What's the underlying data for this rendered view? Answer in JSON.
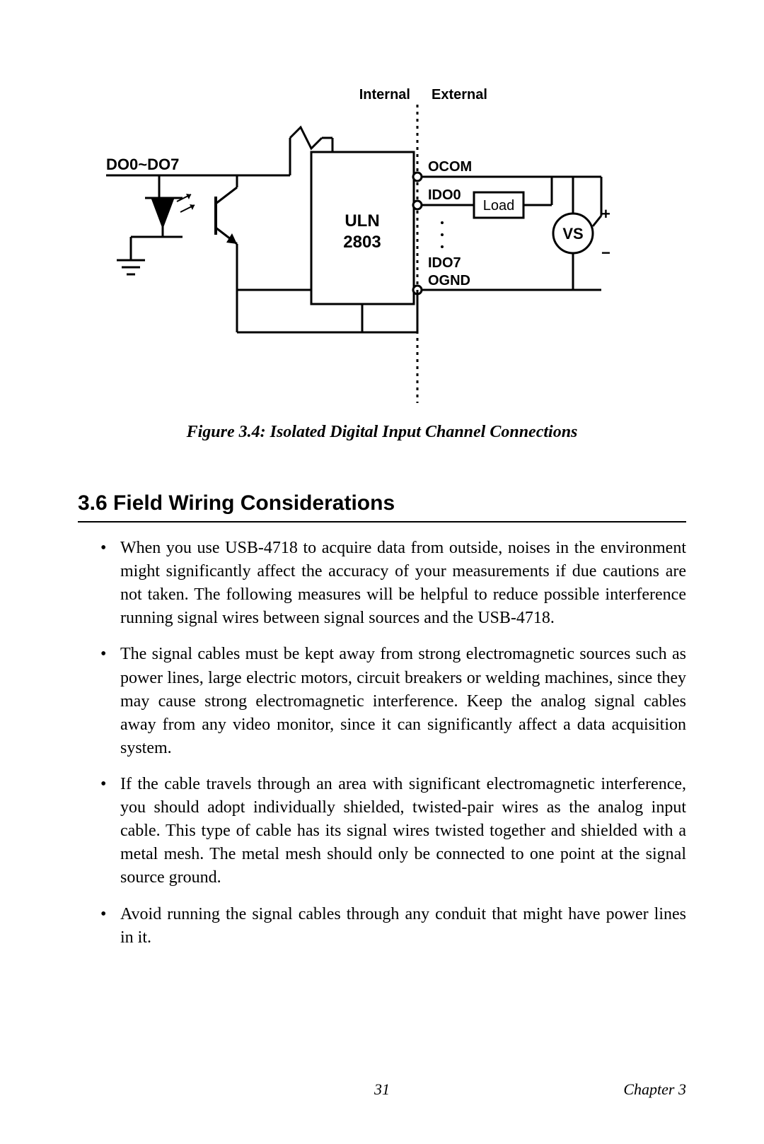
{
  "diagram": {
    "label_internal": "Internal",
    "label_external": "External",
    "do_range": "DO0~DO7",
    "ocom": "OCOM",
    "ido0": "IDO0",
    "ido7": "IDO7",
    "ognd": "OGND",
    "load": "Load",
    "vs": "VS",
    "plus": "+",
    "minus": "−",
    "chip_line1": "ULN",
    "chip_line2": "2803"
  },
  "figure_caption": "Figure 3.4: Isolated Digital Input Channel Connections",
  "section_heading": "3.6  Field Wiring Considerations",
  "bullets": [
    "When you use USB-4718 to acquire data from outside, noises in the environment might significantly affect the accuracy of your measurements if due cautions are not taken. The following measures will be helpful to reduce possible interference running signal wires between signal sources and the USB-4718.",
    "The signal cables must be kept away from strong electromagnetic sources such as power lines, large electric motors, circuit breakers or welding machines, since they may cause strong electromagnetic interference. Keep the analog signal cables away from any video monitor, since it can significantly affect a data acquisition system.",
    "If the cable travels through an area with significant electromagnetic interference, you should adopt individually shielded, twisted-pair wires as the analog input cable. This type of cable has its signal wires twisted together and shielded with a metal mesh. The metal mesh should only be connected to one point at the signal source ground.",
    "Avoid running the signal cables through any conduit that might have power lines in it."
  ],
  "footer": {
    "page": "31",
    "chapter": "Chapter 3"
  }
}
